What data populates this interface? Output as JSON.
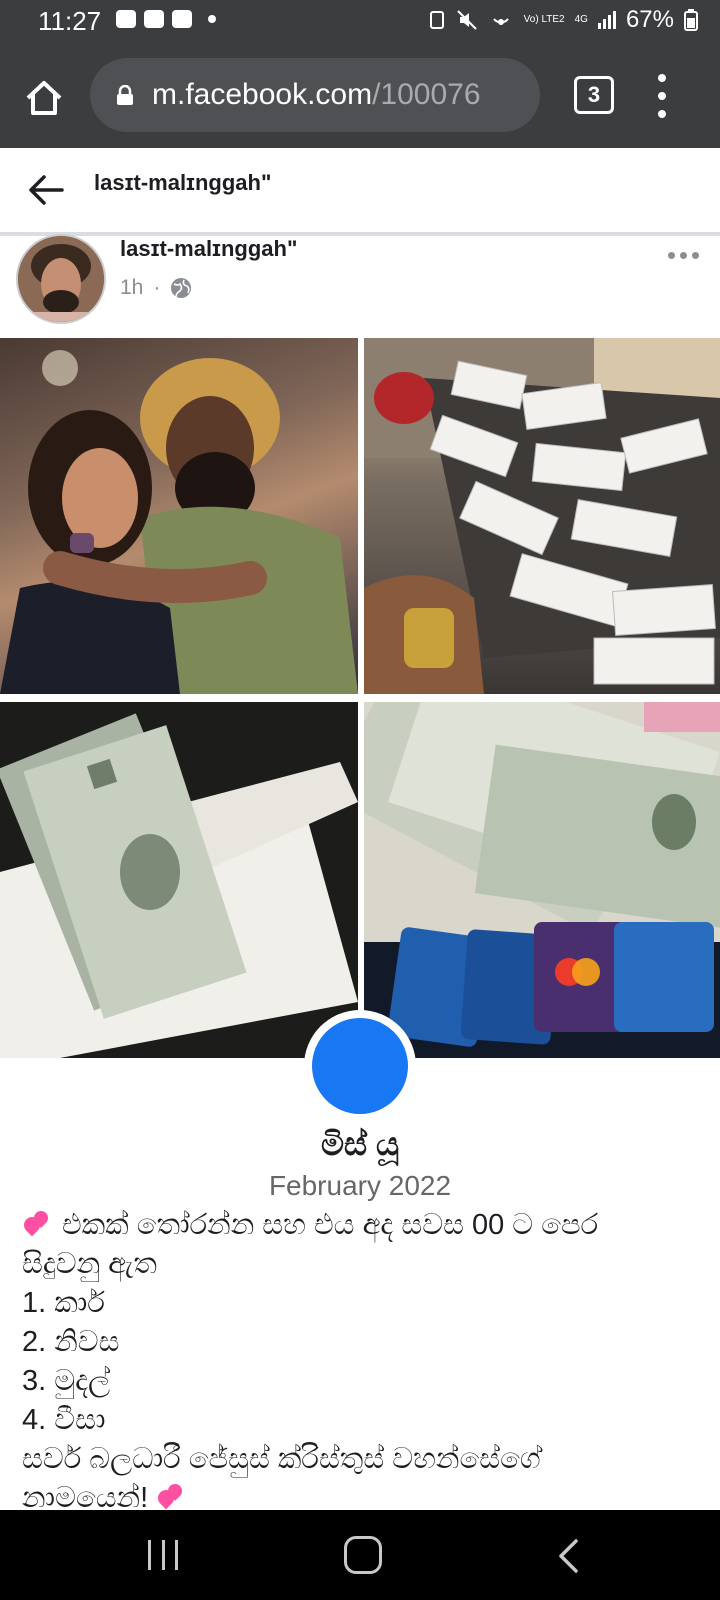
{
  "status_bar": {
    "time": "11:27",
    "network": "Vo) LTE2",
    "network_gen": "4G",
    "battery": "67%"
  },
  "browser": {
    "url_domain": "m.facebook.com",
    "url_path": "/100076",
    "tab_count": "3"
  },
  "page_header": {
    "title": "lasɪt-malɪnggah\""
  },
  "post": {
    "author": "lasɪt-malɪnggah\"",
    "time": "1h",
    "separator": "·",
    "audience_icon": "globe-icon",
    "group": {
      "name": "මිස් යූ",
      "date": "February 2022"
    },
    "body_lines": [
      "එකක් තෝරන්න සහ එය අද සවස 00 ට පෙර",
      "සිදුවනු ඇත",
      "1. කාර්",
      "2. නිවස",
      "3. මුදල්",
      "4. වීසා",
      "සර්ව බලධාරී ජේසුස් ක්රිස්තුස් වහන්සේගේ",
      "නාමයෙන්!"
    ],
    "emoji": "heart-emoji"
  },
  "colors": {
    "chrome_bg": "#3c3d3f",
    "facebook_blue": "#1877f2",
    "meta_gray": "#8a8d91"
  }
}
